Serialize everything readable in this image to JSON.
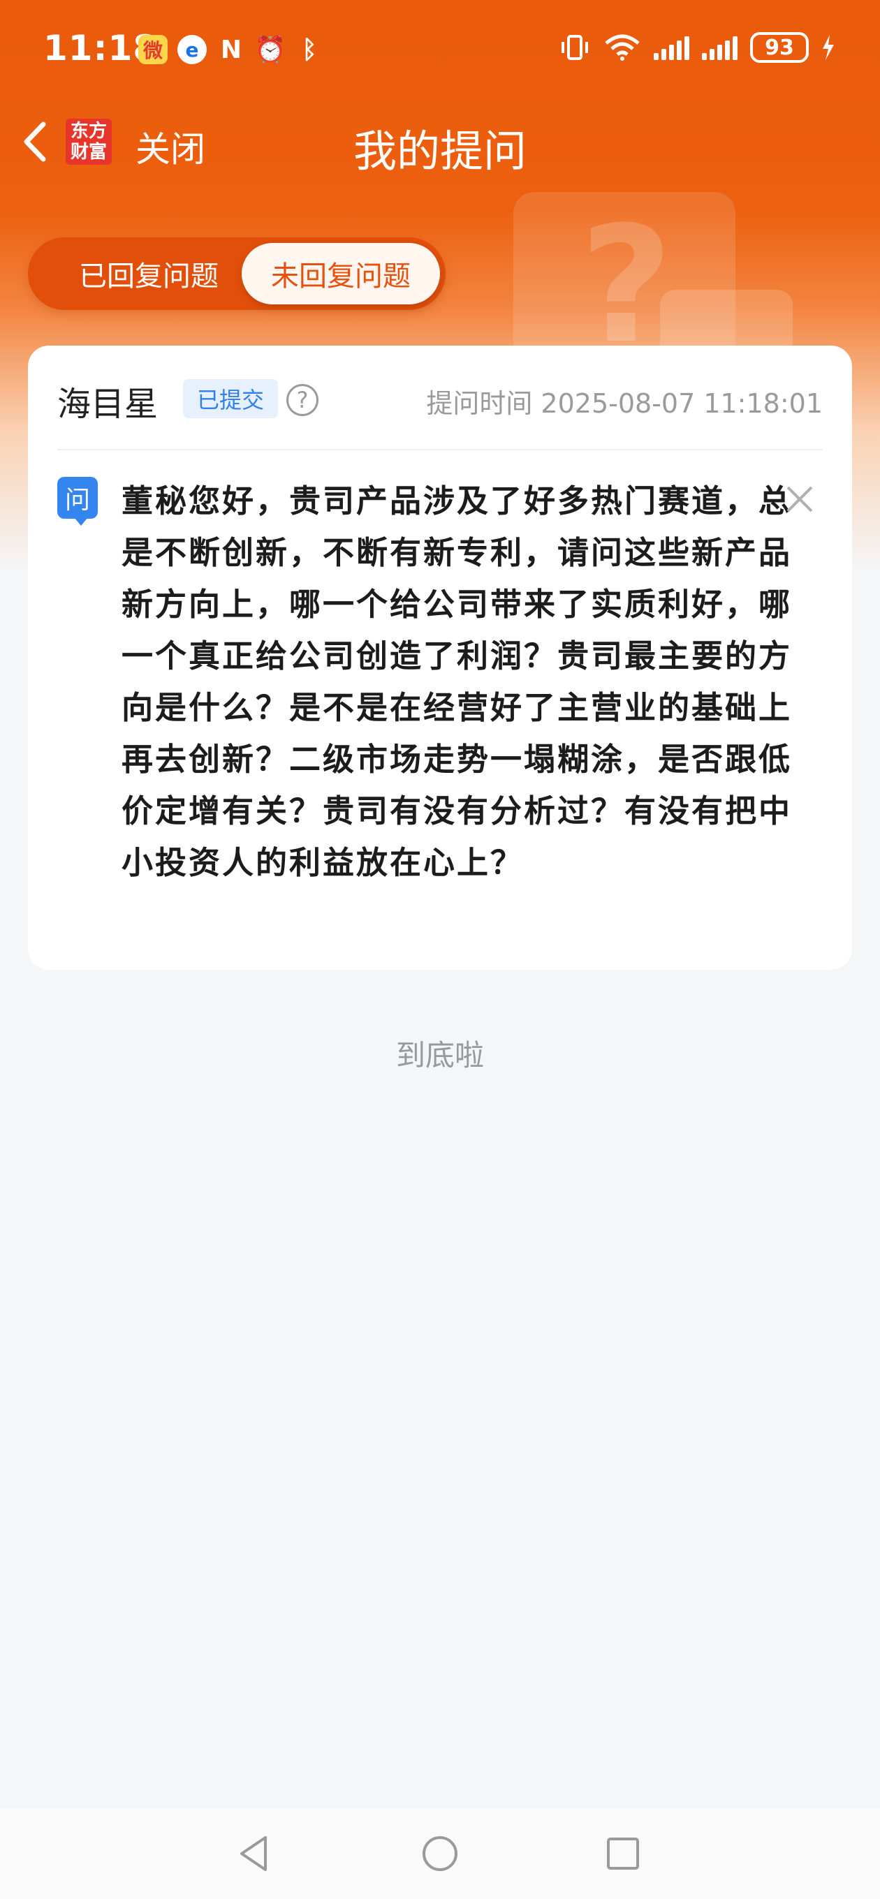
{
  "status_bar": {
    "time": "11:18",
    "battery": "93",
    "icons": [
      "weibo-icon",
      "edge-icon",
      "nfc-icon",
      "alarm-icon",
      "bluetooth-icon",
      "vibrate-icon",
      "wifi-icon",
      "signal-icon",
      "signal-icon",
      "charging-icon"
    ]
  },
  "nav": {
    "logo_text": "东方财富",
    "close_label": "关闭",
    "title": "我的提问"
  },
  "tabs": {
    "answered_label": "已回复问题",
    "unanswered_label": "未回复问题",
    "selected": "unanswered"
  },
  "question_card": {
    "user_name": "海目星",
    "status": "已提交",
    "ask_time": "提问时间 2025-08-07 11:18:01",
    "question_badge": "问",
    "question": "董秘您好，贵司产品涉及了好多热门赛道，总是不断创新，不断有新专利，请问这些新产品新方向上，哪一个给公司带来了实质利好，哪一个真正给公司创造了利润？贵司最主要的方向是什么？是不是在经营好了主营业的基础上再去创新？二级市场走势一塌糊涂，是否跟低价定增有关？贵司有没有分析过？有没有把中小投资人的利益放在心上？"
  },
  "end_text": "到底啦",
  "colors": {
    "brand_orange": "#ea5a0c",
    "badge_blue": "#2f80ed",
    "background": "#f5f6f8"
  }
}
